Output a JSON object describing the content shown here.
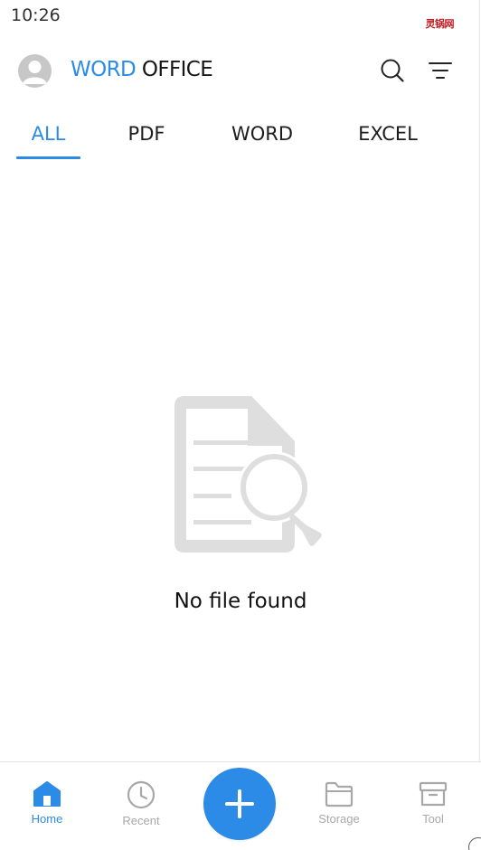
{
  "status_bar": {
    "time": "10:26",
    "logo_text": "灵锅网"
  },
  "header": {
    "title_part1": "WORD",
    "title_part2": " OFFICE",
    "avatar_icon": "person-icon",
    "search_icon": "search-icon",
    "filter_icon": "filter-icon"
  },
  "tabs": [
    {
      "label": "ALL",
      "active": true
    },
    {
      "label": "PDF",
      "active": false
    },
    {
      "label": "WORD",
      "active": false
    },
    {
      "label": "EXCEL",
      "active": false
    }
  ],
  "empty_state": {
    "icon": "document-search-icon",
    "message": "No file found"
  },
  "bottom_nav": {
    "items": [
      {
        "label": "Home",
        "icon": "home-icon",
        "active": true
      },
      {
        "label": "Recent",
        "icon": "clock-icon",
        "active": false
      },
      {
        "label": "Storage",
        "icon": "folder-icon",
        "active": false
      },
      {
        "label": "Tool",
        "icon": "archive-icon",
        "active": false
      }
    ],
    "fab_icon": "plus-icon"
  },
  "colors": {
    "accent": "#2b8be6",
    "inactive": "#a8a8a8",
    "illustration": "#dedede"
  }
}
